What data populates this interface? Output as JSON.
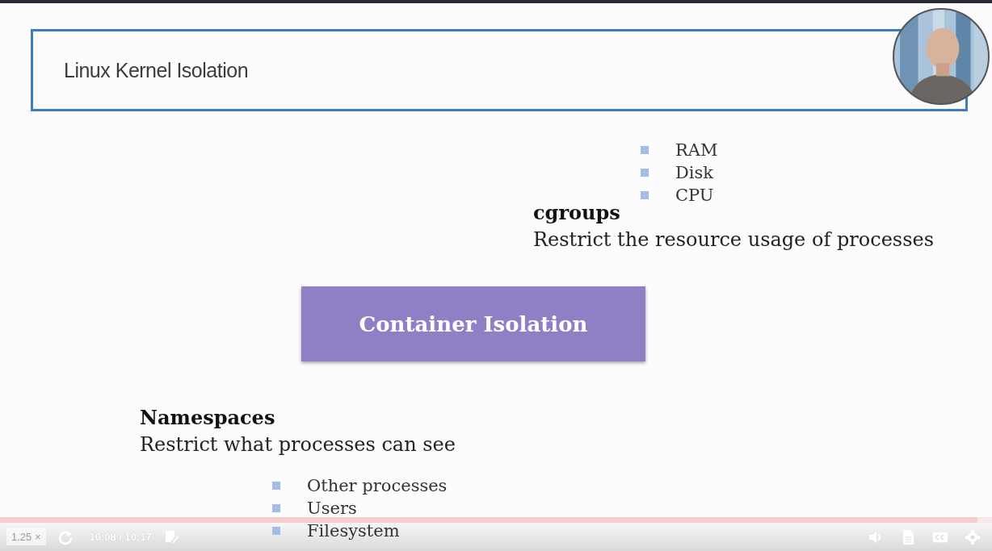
{
  "slide": {
    "title": "Linux Kernel Isolation",
    "center_box": "Container Isolation",
    "cgroups": {
      "heading": "cgroups",
      "text": "Restrict the resource usage of processes",
      "bullets": [
        "RAM",
        "Disk",
        "CPU"
      ]
    },
    "namespaces": {
      "heading": "Namespaces",
      "text": "Restrict what processes can see",
      "bullets": [
        "Other processes",
        "Users",
        "Filesystem"
      ]
    }
  },
  "player": {
    "progress": {
      "level": 0.985
    },
    "speed": "1.25 ×",
    "time": "10:08 / 10:17"
  }
}
